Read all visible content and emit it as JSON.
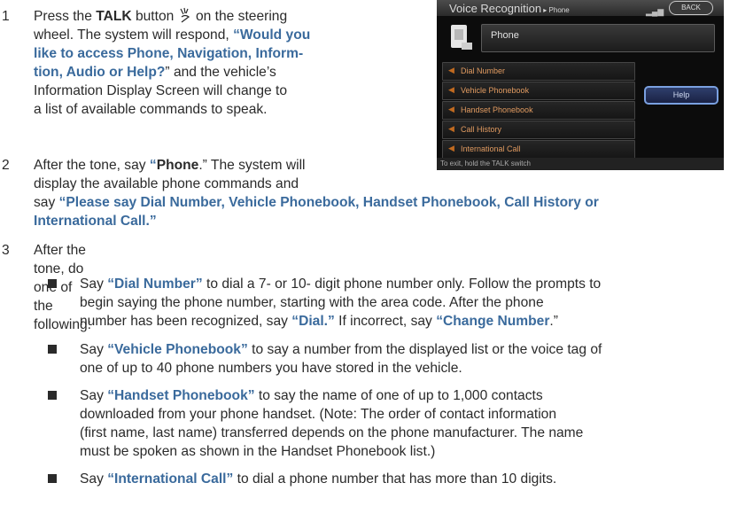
{
  "steps": [
    {
      "num": "1",
      "line1a": "Press the ",
      "line1b": "TALK",
      "line1c": " button",
      "line1d": " on the steering",
      "line2a": "wheel. The system will respond, ",
      "line2b": "“Would you",
      "line3": "like to access Phone, Navigation, Inform-",
      "line4a": "tion, Audio or Help?",
      "line4b": "” and the vehicle’s",
      "line5": "Information Display Screen will change to",
      "line6": "a list of available commands to speak."
    },
    {
      "num": "2",
      "line1a": " After the tone, say ",
      "line1b": "“",
      "line1c": "Phone",
      "line1d": ".” The system will",
      "line2": "display the available phone commands and",
      "line3a": "say ",
      "line3b": "“Please say Dial Number, Vehicle Phonebook, Handset Phonebook, Call History or",
      "line4": "International Call.”"
    },
    {
      "num": "3",
      "line1": "After the tone, do one of the following:"
    }
  ],
  "bullets": [
    {
      "l1a": "Say ",
      "l1b": "“Dial Number”",
      "l1c": " to dial a 7- or 10- digit phone number only. Follow the prompts to",
      "l2": "begin saying the phone number, starting with the area code. After the phone",
      "l3a": "number has been recognized, say ",
      "l3b": "“Dial.”",
      "l3c": " If incorrect, say ",
      "l3d": "“Change Number",
      "l3e": ".”"
    },
    {
      "l1a": "Say ",
      "l1b": "“Vehicle Phonebook”",
      "l1c": " to say a number from the displayed list or the voice tag of",
      "l2": "one of up to 40 phone numbers you have stored in the vehicle."
    },
    {
      "l1a": "Say ",
      "l1b": "“Handset Phonebook”",
      "l1c": " to say the name of one of up to 1,000 contacts",
      "l2": "downloaded from your phone handset. (Note: The order of contact information",
      "l3": "(first name, last name) transferred depends on the phone manufacturer. The name",
      "l4": "must be spoken as shown in the Handset Phonebook list.)"
    },
    {
      "l1a": "Say ",
      "l1b": "“International Call”",
      "l1c": " to dial a phone number that has more than 10 digits."
    }
  ],
  "screen": {
    "title": "Voice Recognition",
    "title_suffix": " ▸ Phone",
    "back_label": "BACK",
    "phone_label": "Phone",
    "items": [
      "Dial Number",
      "Vehicle Phonebook",
      "Handset Phonebook",
      "Call History",
      "International Call"
    ],
    "help_label": "Help",
    "footer": "To exit, hold the TALK switch"
  },
  "colors": {
    "text_accent": "#3a6a9c",
    "body_text": "#2a2a2a",
    "screen_item_text": "#e09a60"
  }
}
